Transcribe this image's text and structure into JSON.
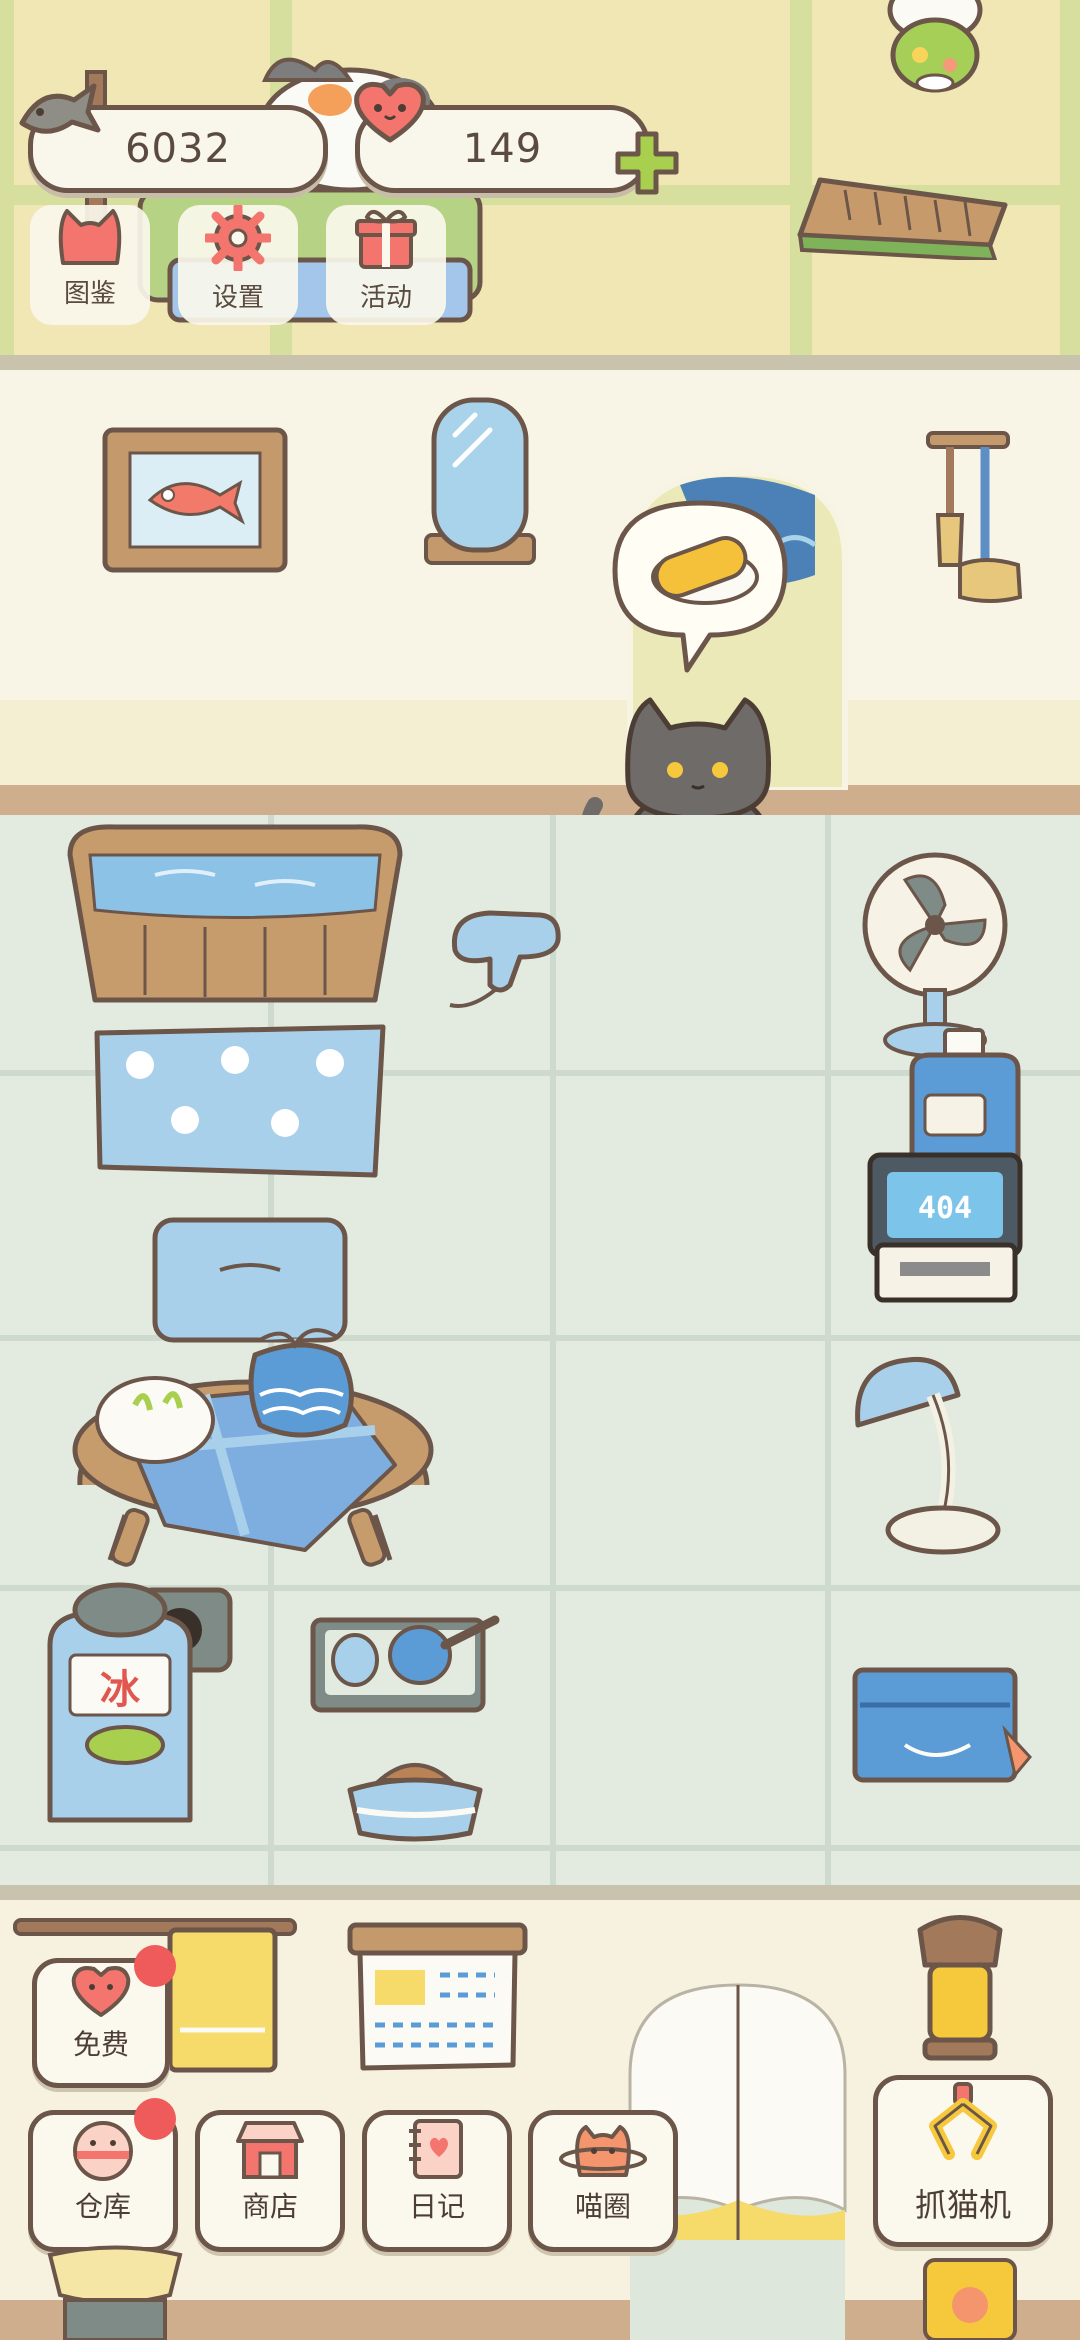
{
  "hud": {
    "fish_coins": "6032",
    "hearts": "149"
  },
  "top_menu": {
    "catalog_label": "图鉴",
    "settings_label": "设置",
    "events_label": "活动"
  },
  "scene": {
    "bubble_item": "sushi",
    "router_text": "404",
    "shaved_ice_sign": "冰"
  },
  "bottom_menu": {
    "free_label": "免费",
    "warehouse_label": "仓库",
    "shop_label": "商店",
    "diary_label": "日记",
    "circle_label": "喵圈",
    "claw_label": "抓猫机"
  },
  "colors": {
    "accent_pink": "#f4756e",
    "notification_red": "#ef5a5a",
    "outline_brown": "#6b5649",
    "plus_green": "#a9cf4f"
  }
}
